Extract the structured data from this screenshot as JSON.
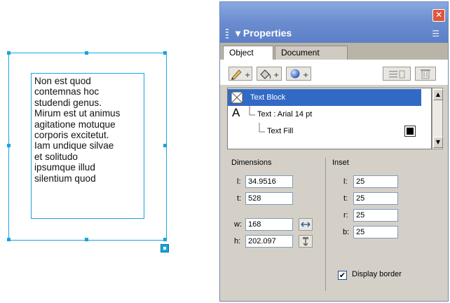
{
  "canvas": {
    "text_lines": [
      "Non est quod",
      "contemnas hoc",
      "studendi genus.",
      "Mirum est ut animus",
      "agitatione motuque",
      "corporis excitetut.",
      "Iam undique silvae",
      "et solitudo",
      "ipsumque illud",
      "silentium quod"
    ]
  },
  "window": {
    "close_glyph": "✕",
    "panel_title": "▾ Properties",
    "menu_glyph": "☰"
  },
  "tabs": [
    "Object",
    "Document"
  ],
  "toolbar": {
    "icons": [
      "pencil-icon",
      "fill-bucket-icon",
      "sphere-icon",
      "align-icon",
      "trash-icon"
    ],
    "dropdown_glyph": "+"
  },
  "tree": {
    "rows": [
      {
        "label": "Text Block",
        "icon": "frame-x-icon",
        "selected": true
      },
      {
        "label": "Text : Arial 14 pt",
        "icon": "letter-a-icon",
        "glyph": "A"
      },
      {
        "label": "Text Fill",
        "icon": "swatch-icon"
      }
    ]
  },
  "dimensions": {
    "title": "Dimensions",
    "l_label": "l:",
    "l_value": "34.9516",
    "t_label": "t:",
    "t_value": "528",
    "w_label": "w:",
    "w_value": "168",
    "h_label": "h:",
    "h_value": "202.097"
  },
  "inset": {
    "title": "Inset",
    "l_label": "l:",
    "l_value": "25",
    "t_label": "t:",
    "t_value": "25",
    "r_label": "r:",
    "r_value": "25",
    "b_label": "b:",
    "b_value": "25"
  },
  "display_border": {
    "label": "Display border",
    "checked": true,
    "check_glyph": "✔"
  },
  "colors": {
    "selection": "#1aa3e0",
    "title_bar": "#6a8ccf",
    "tree_selected": "#316ac5"
  }
}
